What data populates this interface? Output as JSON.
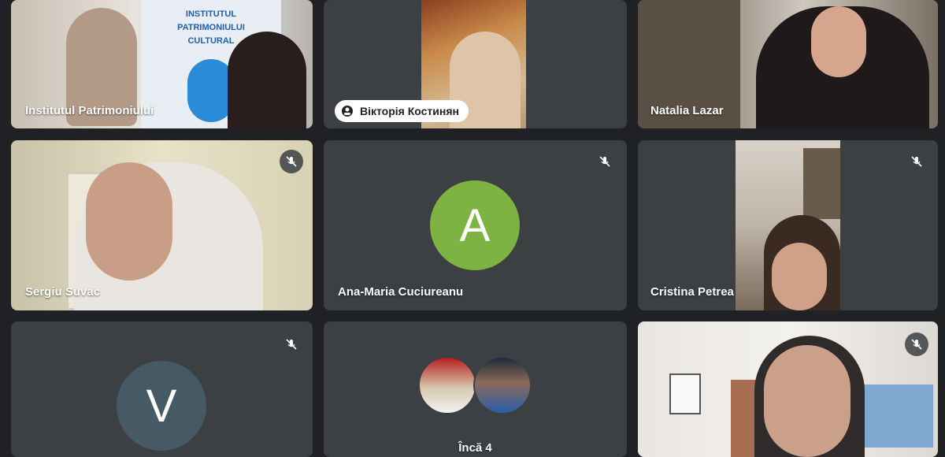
{
  "participants": [
    {
      "name": "Institutul Patrimoniului",
      "muted": false
    },
    {
      "name": "Вікторія Костинян",
      "muted": false
    },
    {
      "name": "Natalia Lazar",
      "muted": false,
      "active_speaker": true
    },
    {
      "name": "Sergiu Suvac",
      "muted": true
    },
    {
      "name": "Ana-Maria Cuciureanu",
      "muted": true,
      "avatar_letter": "A",
      "avatar_color": "#7cb342"
    },
    {
      "name": "Cristina Petrea",
      "muted": true
    },
    {
      "name": "",
      "muted": true,
      "avatar_letter": "V",
      "avatar_color": "#455a64"
    },
    {
      "name": "",
      "muted": false,
      "overflow_label": "Încă 4"
    },
    {
      "name": "",
      "muted": true
    }
  ],
  "banner": {
    "line1": "INSTITUTUL",
    "line2": "PATRIMONIULUI",
    "line3": "CULTURAL"
  },
  "icons": {
    "mute": "mic-off-icon",
    "pin": "pin-icon"
  },
  "colors": {
    "tile_bg": "#3c4043",
    "page_bg": "#202124",
    "active_border": "#8ab4f8"
  }
}
